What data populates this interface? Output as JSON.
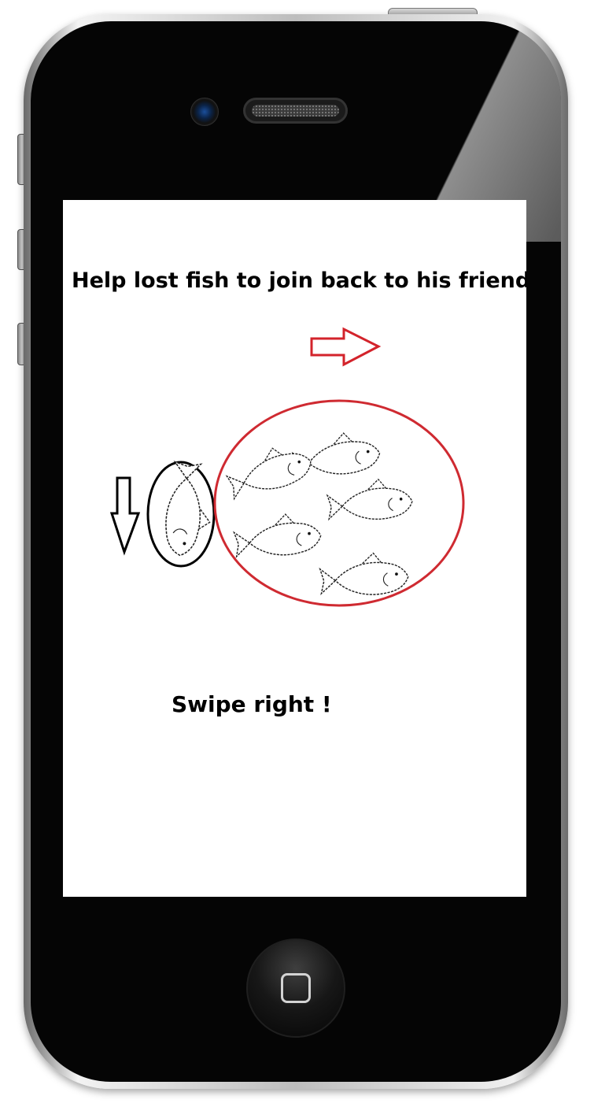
{
  "screen": {
    "instruction": "Help lost fish to join back to his friends !",
    "swipe_hint": "Swipe right !"
  },
  "colors": {
    "arrow_red": "#d3232b",
    "circle_red": "#cf2a31",
    "lost_fish_circle": "#000000"
  },
  "icons": {
    "right_arrow": "right-arrow-icon",
    "down_arrow": "down-arrow-icon",
    "lost_fish": "lost-fish-icon",
    "school_fish": "fish-icon"
  }
}
